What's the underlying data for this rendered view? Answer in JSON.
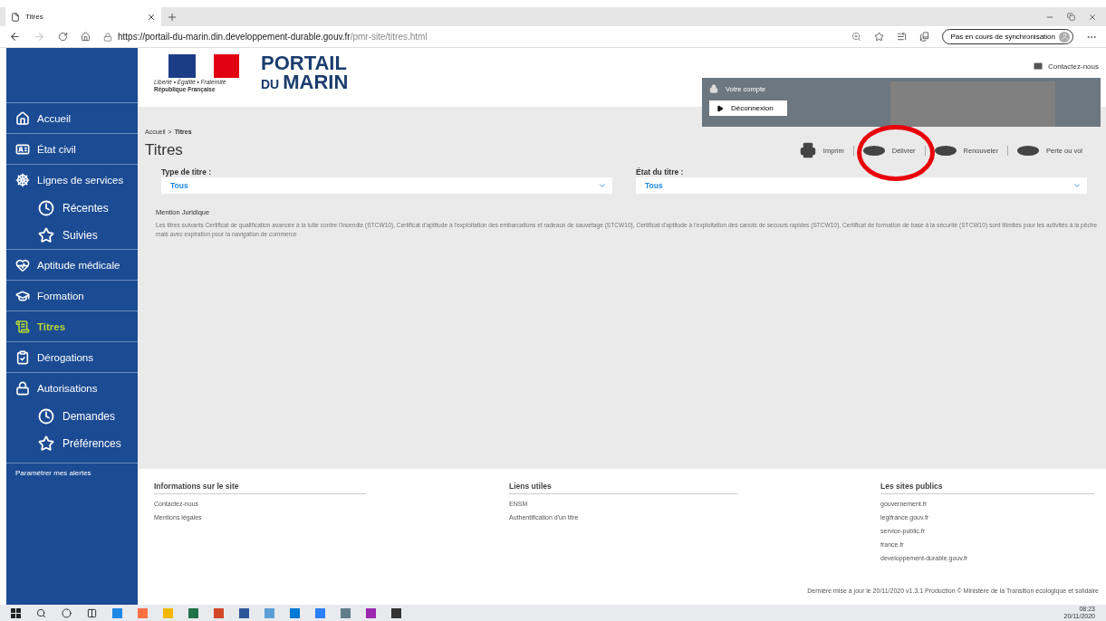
{
  "browser": {
    "tab_title": "Titres",
    "url_host": "https://portail-du-marin.din.developpement-durable.gouv.fr",
    "url_path": "/pmr-site/titres.html",
    "sync_label": "Pas en cours de synchronisation"
  },
  "header": {
    "logo": {
      "motto": "Liberté • Égalité • Fraternité",
      "republic": "République Française",
      "name_top": "PORTAIL",
      "name_small": "DU",
      "name_bottom": "MARIN"
    },
    "contact": "Contactez-nous",
    "account": {
      "title": "Votre compte",
      "logout": "Déconnexion"
    }
  },
  "sidebar": {
    "items": [
      {
        "label": "Accueil",
        "kind": "main",
        "selected": false
      },
      {
        "label": "État civil",
        "kind": "main",
        "selected": false
      },
      {
        "label": "Lignes de services",
        "kind": "main",
        "selected": false
      },
      {
        "label": "Récentes",
        "kind": "sub",
        "selected": false
      },
      {
        "label": "Suivies",
        "kind": "sub",
        "selected": false
      },
      {
        "label": "Aptitude médicale",
        "kind": "main",
        "selected": false
      },
      {
        "label": "Formation",
        "kind": "main",
        "selected": false
      },
      {
        "label": "Titres",
        "kind": "main",
        "selected": true
      },
      {
        "label": "Dérogations",
        "kind": "main",
        "selected": false
      },
      {
        "label": "Autorisations",
        "kind": "main",
        "selected": false
      },
      {
        "label": "Demandes",
        "kind": "sub",
        "selected": false
      },
      {
        "label": "Préférences",
        "kind": "sub",
        "selected": false
      }
    ],
    "alerts_link": "Paramétrer mes alertes"
  },
  "breadcrumb": {
    "parent": "Accueil",
    "separator": ">",
    "current": "Titres"
  },
  "page_title": "Titres",
  "actions": [
    {
      "label": "Imprim",
      "kind": "print"
    },
    {
      "label": "Délivrer",
      "kind": "cerfa"
    },
    {
      "label": "Renouveler",
      "kind": "cerfa"
    },
    {
      "label": "Perte ou vol",
      "kind": "cerfa"
    }
  ],
  "filters": [
    {
      "label": "Type de titre :",
      "value": "Tous"
    },
    {
      "label": "État du titre :",
      "value": "Tous"
    }
  ],
  "legal": {
    "title": "Mention Juridique",
    "text": "Les titres suivants Certificat de qualification avancée à la lutte contre l'incendie (STCW10), Certificat d'aptitude à l'exploitation des embarcations et radeaux de sauvetage (STCW10), Certificat d'aptitude à l'exploitation des canots de secours rapides (STCW10), Certificat de formation de base à la sécurité (STCW10) sont illimités pour les activités à la pêche mais avec expiration pour la navigation de commerce"
  },
  "footer": {
    "columns": [
      {
        "title": "Informations sur le site",
        "links": [
          "Contactez-nous",
          "Mentions légales"
        ]
      },
      {
        "title": "Liens utiles",
        "links": [
          "ENSM",
          "Authentification d'un titre"
        ]
      },
      {
        "title": "Les sites publics",
        "links": [
          "gouvernement.fr",
          "legifrance.gouv.fr",
          "service-public.fr",
          "france.fr",
          "developpement-durable.gouv.fr"
        ]
      }
    ],
    "note": "Dernière mise à jour le 20/11/2020 v1.3.1 Production © Ministère de la Transition écologique et solidaire"
  },
  "taskbar": {
    "time": "08:23",
    "date": "20/11/2020"
  }
}
